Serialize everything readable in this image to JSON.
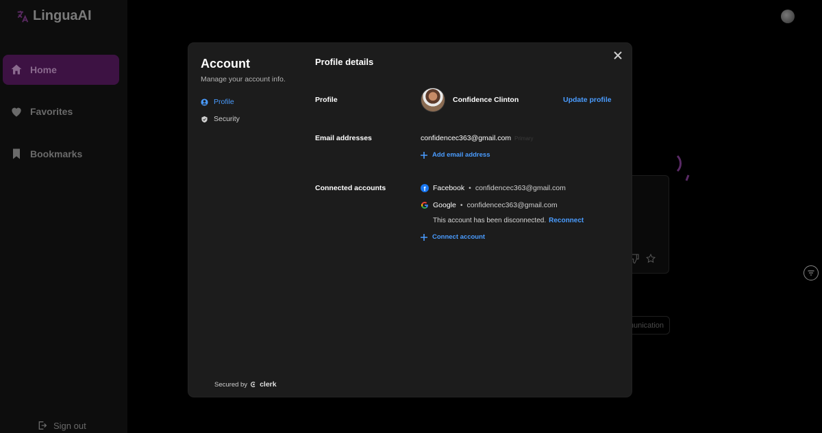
{
  "app": {
    "name": "LinguaAI",
    "sidebar": {
      "items": [
        {
          "label": "Home",
          "icon": "home-icon",
          "active": true
        },
        {
          "label": "Favorites",
          "icon": "heart-icon",
          "active": false
        },
        {
          "label": "Bookmarks",
          "icon": "bookmark-icon",
          "active": false
        }
      ],
      "sign_out_label": "Sign out"
    },
    "background": {
      "chip_label": "nunication"
    }
  },
  "modal": {
    "title": "Account",
    "subtitle": "Manage your account info.",
    "nav": {
      "profile_label": "Profile",
      "security_label": "Security"
    },
    "secured_by_label": "Secured by",
    "secured_by_brand": "clerk",
    "section_title": "Profile details",
    "profile": {
      "label": "Profile",
      "name": "Confidence Clinton",
      "update_link": "Update profile"
    },
    "emails": {
      "label": "Email addresses",
      "address": "confidencec363@gmail.com",
      "badge": "Primary",
      "add_link": "Add email address"
    },
    "connected": {
      "label": "Connected accounts",
      "accounts": [
        {
          "provider": "Facebook",
          "email": "confidencec363@gmail.com",
          "icon": "facebook-icon"
        },
        {
          "provider": "Google",
          "email": "confidencec363@gmail.com",
          "icon": "google-icon"
        }
      ],
      "disconnected_text": "This account has been disconnected.",
      "reconnect_link": "Reconnect",
      "connect_link": "Connect account"
    }
  },
  "colors": {
    "accent": "#4a9cff",
    "active_nav_bg": "#3d1243",
    "modal_bg": "#1c1c1c"
  }
}
